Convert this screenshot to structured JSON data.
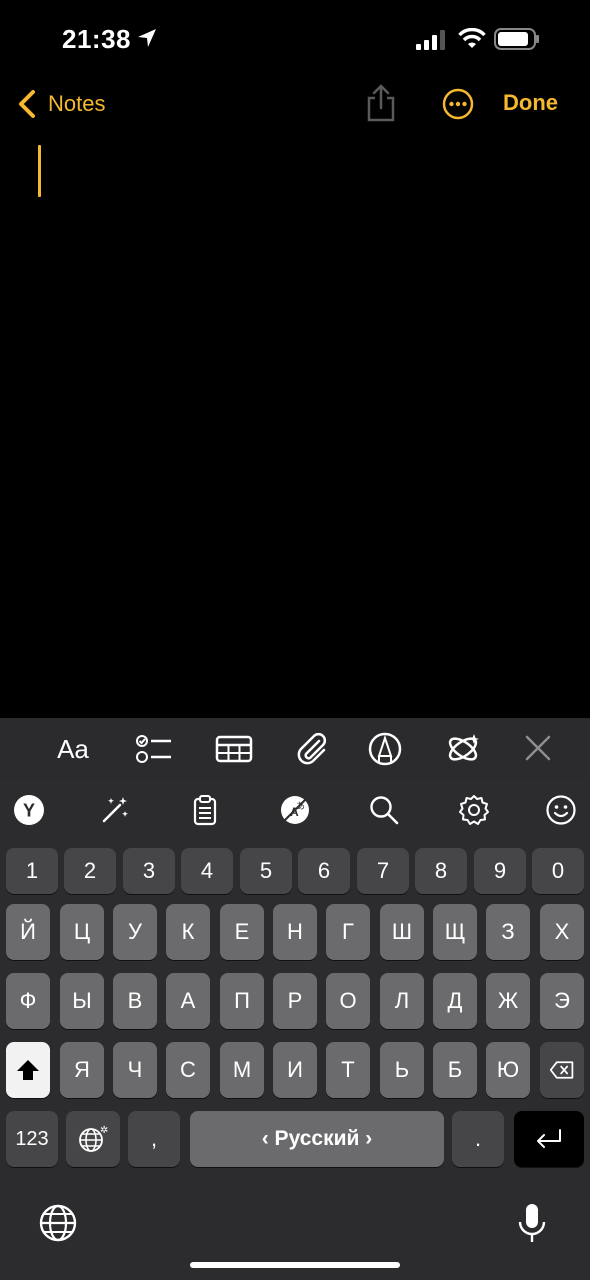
{
  "status_bar": {
    "time": "21:38"
  },
  "nav": {
    "back_label": "Notes",
    "done_label": "Done"
  },
  "format_toolbar": {
    "text_style_label": "Aa"
  },
  "keyboard": {
    "toolbar_logo": "Y",
    "number_row": [
      "1",
      "2",
      "3",
      "4",
      "5",
      "6",
      "7",
      "8",
      "9",
      "0"
    ],
    "row1": [
      "Й",
      "Ц",
      "У",
      "К",
      "Е",
      "Н",
      "Г",
      "Ш",
      "Щ",
      "З",
      "Х"
    ],
    "row2": [
      "Ф",
      "Ы",
      "В",
      "А",
      "П",
      "Р",
      "О",
      "Л",
      "Д",
      "Ж",
      "Э"
    ],
    "row3": [
      "Я",
      "Ч",
      "С",
      "М",
      "И",
      "Т",
      "Ь",
      "Б",
      "Ю"
    ],
    "mode_switch_label": "123",
    "comma_label": ",",
    "space_label": "‹ Русский ›",
    "period_label": "."
  },
  "colors": {
    "accent": "#f5b82e",
    "background": "#000000",
    "keyboard_bg": "#2c2c2e",
    "key_bg": "#6b6b6d",
    "func_key_bg": "#464648"
  }
}
